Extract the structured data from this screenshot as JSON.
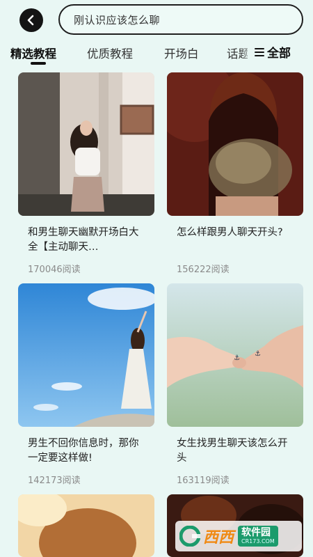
{
  "search": {
    "query": "刚认识应该怎么聊"
  },
  "icons": {
    "back": "back-arrow-icon",
    "menu": "menu-icon"
  },
  "tabs": [
    {
      "label": "精选教程",
      "active": true
    },
    {
      "label": "优质教程",
      "active": false
    },
    {
      "label": "开场白",
      "active": false
    },
    {
      "label": "话题",
      "active": false
    }
  ],
  "all_button": {
    "label": "全部"
  },
  "cards": [
    {
      "title": "和男生聊天幽默开场白大全【主动聊天…",
      "reads": "170046阅读"
    },
    {
      "title": "怎么样跟男人聊天开头?",
      "reads": "156222阅读"
    },
    {
      "title": "男生不回你信息时，那你一定要这样做!",
      "reads": "142173阅读"
    },
    {
      "title": "女生找男生聊天该怎么开头",
      "reads": "163119阅读"
    }
  ],
  "watermark": {
    "brand": "西西",
    "site": "软件园",
    "url": "CR173.COM"
  },
  "colors": {
    "background": "#e9f7f4",
    "accent": "#111111",
    "secondary_text": "#8a8a8a"
  }
}
